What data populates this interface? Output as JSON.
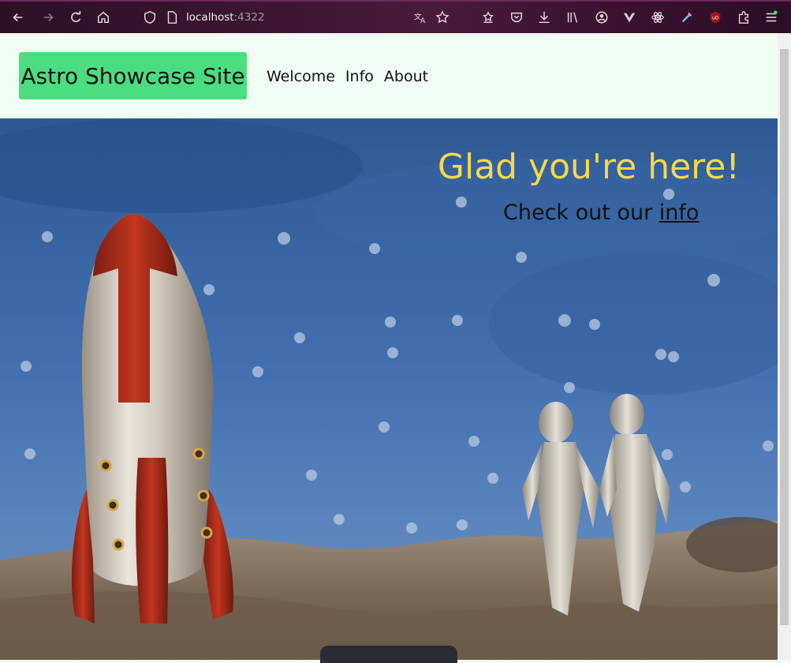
{
  "browser": {
    "url_host": "localhost",
    "url_port": ":4322",
    "icons": [
      "back-icon",
      "forward-icon",
      "reload-icon",
      "home-icon",
      "shield-icon",
      "page-icon",
      "translate-icon",
      "bookmark-star-icon",
      "sync-icon",
      "pocket-icon",
      "download-icon",
      "library-icon",
      "account-icon",
      "vue-devtools-icon",
      "react-devtools-icon",
      "eyedropper-icon",
      "ublock-icon",
      "extensions-icon",
      "menu-icon"
    ]
  },
  "site": {
    "brand": "Astro Showcase Site",
    "nav": [
      "Welcome",
      "Info",
      "About"
    ]
  },
  "hero": {
    "title": "Glad you're here!",
    "sub_prefix": "Check out our ",
    "sub_link": "info"
  },
  "colors": {
    "brand_bg": "#4ade80",
    "page_bg": "#f0fdf2",
    "hero_title": "#f5d94a"
  }
}
